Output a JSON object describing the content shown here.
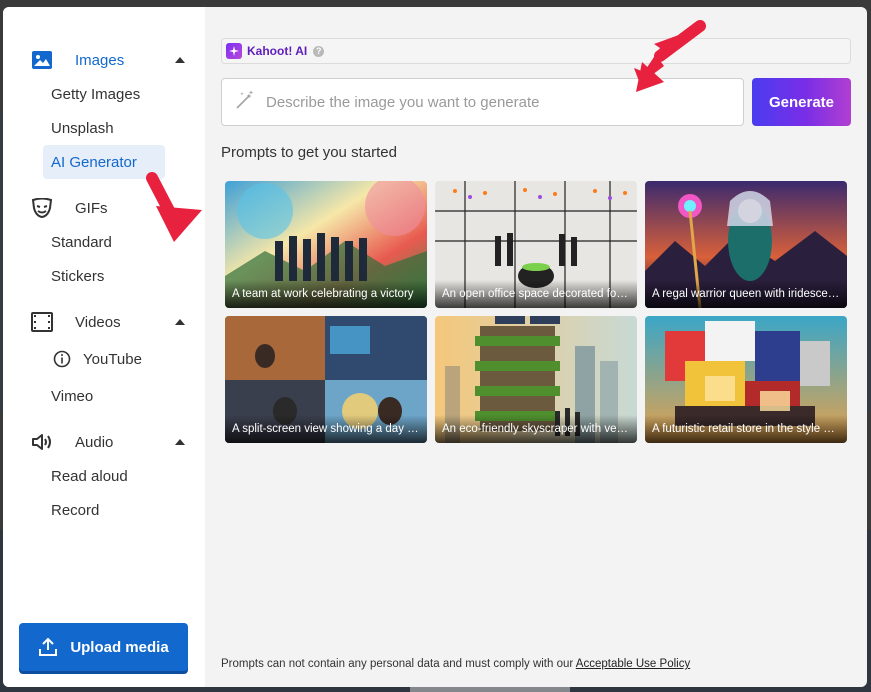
{
  "sidebar": {
    "groups": [
      {
        "label": "Images",
        "icon": "image-icon",
        "items": [
          "Getty Images",
          "Unsplash",
          "AI Generator"
        ]
      },
      {
        "label": "GIFs",
        "icon": "gif-mask-icon",
        "items": [
          "Standard",
          "Stickers"
        ]
      },
      {
        "label": "Videos",
        "icon": "film-icon",
        "items": [
          "YouTube",
          "Vimeo"
        ]
      },
      {
        "label": "Audio",
        "icon": "speaker-icon",
        "items": [
          "Read aloud",
          "Record"
        ]
      }
    ],
    "selected_item": "AI Generator",
    "upload_label": "Upload media"
  },
  "ai_badge": {
    "label": "Kahoot! AI"
  },
  "prompt": {
    "placeholder": "Describe the image you want to generate",
    "value": "",
    "generate_label": "Generate"
  },
  "suggestions_title": "Prompts to get you started",
  "suggestions": [
    {
      "caption": "A team at work celebrating a victory"
    },
    {
      "caption": "An open office space decorated for Halloween"
    },
    {
      "caption": "A regal warrior queen with iridescent armor"
    },
    {
      "caption": "A split-screen view showing a day at work"
    },
    {
      "caption": "An eco-friendly skyscraper with vertical gardens"
    },
    {
      "caption": "A futuristic retail store in the style of cubism"
    }
  ],
  "footer": {
    "text": "Prompts can not contain any personal data and must comply with our ",
    "link": "Acceptable Use Policy"
  },
  "colors": {
    "accent": "#1368ce",
    "ai_purple": "#5f1dbb",
    "annotation_arrow": "#e8213f"
  }
}
